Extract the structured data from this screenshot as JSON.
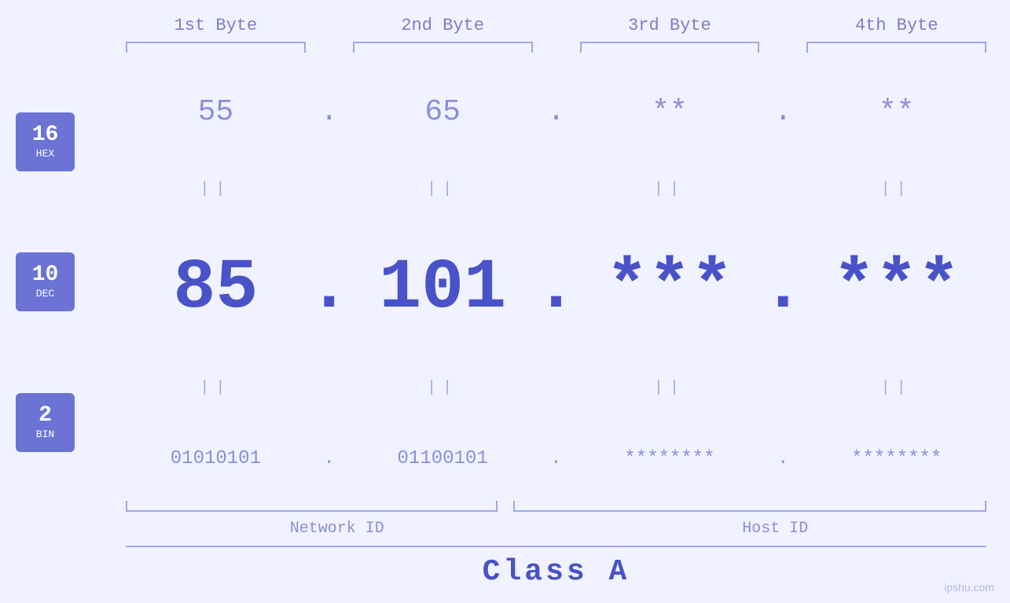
{
  "page": {
    "background": "#f0f2ff",
    "watermark": "ipshu.com"
  },
  "headers": {
    "byte1": "1st Byte",
    "byte2": "2nd Byte",
    "byte3": "3rd Byte",
    "byte4": "4th Byte"
  },
  "badges": {
    "hex": {
      "number": "16",
      "label": "HEX"
    },
    "dec": {
      "number": "10",
      "label": "DEC"
    },
    "bin": {
      "number": "2",
      "label": "BIN"
    }
  },
  "rows": {
    "hex": {
      "b1": "55",
      "b2": "65",
      "b3": "**",
      "b4": "**",
      "dot": "."
    },
    "dec": {
      "b1": "85",
      "b2": "101.",
      "b3": "***",
      "b4": "***",
      "dot": "."
    },
    "bin": {
      "b1": "01010101",
      "b2": "01100101",
      "b3": "********",
      "b4": "********",
      "dot": "."
    }
  },
  "labels": {
    "network_id": "Network ID",
    "host_id": "Host ID",
    "class": "Class A"
  },
  "separators": {
    "equals": "||"
  }
}
